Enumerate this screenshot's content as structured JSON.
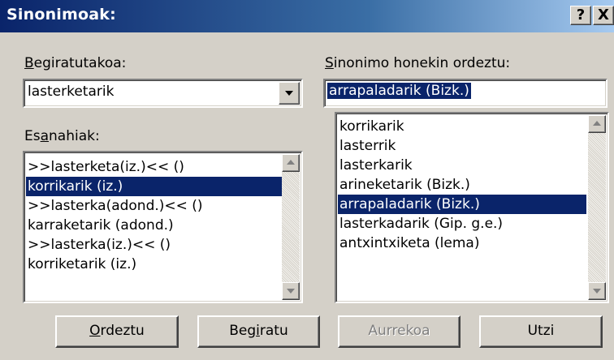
{
  "window": {
    "title": "Sinonimoak:",
    "help_label": "?",
    "close_label": "X"
  },
  "lookup": {
    "label_accel": "B",
    "label_rest": "egiratutakoa:",
    "value": "lasterketarik"
  },
  "replace": {
    "label_accel": "S",
    "label_rest": "inonimo honekin ordeztu:",
    "value": "arrapaladarik (Bizk.)"
  },
  "meanings": {
    "label_pre": "Es",
    "label_accel": "a",
    "label_post": "nahiak:",
    "items": [
      ">>lasterketa(iz.)<< ()",
      "korrikarik (iz.)",
      ">>lasterka(adond.)<< ()",
      "karraketarik (adond.)",
      ">>lasterka(iz.)<< ()",
      "korriketarik (iz.)"
    ],
    "selected_index": 1
  },
  "synonyms": {
    "items": [
      "korrikarik",
      "lasterrik",
      "lasterkarik",
      "arineketarik (Bizk.)",
      "arrapaladarik (Bizk.)",
      "lasterkadarik (Gip. g.e.)",
      "antxintxiketa (lema)"
    ],
    "selected_index": 4
  },
  "buttons": {
    "replace_accel": "O",
    "replace_rest": "rdeztu",
    "lookup_pre": "Beg",
    "lookup_accel": "i",
    "lookup_post": "ratu",
    "previous": "Aurrekoa",
    "cancel": "Utzi"
  },
  "colors": {
    "selection": "#0a246a",
    "face": "#d4d0c8",
    "title_start": "#0a246a",
    "title_end": "#a6caf0"
  }
}
